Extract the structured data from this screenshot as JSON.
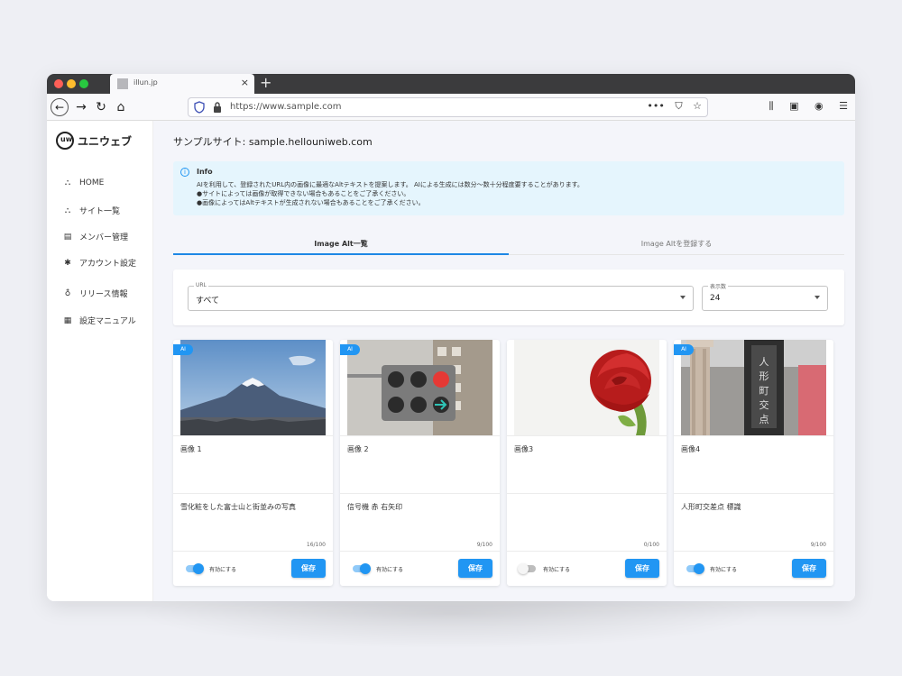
{
  "browser": {
    "tab_title": "illun.jp",
    "tab_close": "×",
    "new_tab": "+",
    "url": "https://www.sample.com",
    "url_more": "•••"
  },
  "sidebar": {
    "logo_text": "ユニウェブ",
    "items": [
      {
        "label": "HOME",
        "icon": "home-icon"
      },
      {
        "label": "サイト一覧",
        "icon": "sitemap-icon"
      },
      {
        "label": "メンバー管理",
        "icon": "id-card-icon"
      },
      {
        "label": "アカウント設定",
        "icon": "gear-icon"
      },
      {
        "label": "リリース情報",
        "icon": "lightbulb-icon"
      },
      {
        "label": "設定マニュアル",
        "icon": "document-icon"
      }
    ]
  },
  "main": {
    "site_title": "サンプルサイト: sample.hellouniweb.com",
    "info": {
      "title": "Info",
      "lines": [
        "AIを利用して、登録されたURL内の画像に最適なAltテキストを提案します。 AIによる生成には数分〜数十分程度要することがあります。",
        "●サイトによっては画像が取得できない場合もあることをご了承ください。",
        "●画像によってはAltテキストが生成されない場合もあることをご了承ください。"
      ]
    },
    "tabs": [
      {
        "label": "Image Alt一覧",
        "active": true
      },
      {
        "label": "Image Altを登録する",
        "active": false
      }
    ],
    "filters": {
      "url_label": "URL",
      "url_value": "すべて",
      "count_label": "表示数",
      "count_value": "24"
    },
    "toggle_label": "有効にする",
    "save_label": "保存",
    "ai_badge": "AI",
    "cards": [
      {
        "title": "画像 1",
        "alt": "雪化粧をした富士山と街並みの写真",
        "count": "16/100",
        "enabled": true,
        "ai": true
      },
      {
        "title": "画像 2",
        "alt": "信号機 赤 右矢印",
        "count": "9/100",
        "enabled": true,
        "ai": true
      },
      {
        "title": "画像3",
        "alt": "",
        "count": "0/100",
        "enabled": false,
        "ai": false
      },
      {
        "title": "画像4",
        "alt": "人形町交差点 標識",
        "count": "9/100",
        "enabled": true,
        "ai": true
      }
    ]
  },
  "colors": {
    "accent": "#2196f3",
    "info_bg": "#e5f5fd",
    "page_bg": "#f4f5fa"
  }
}
